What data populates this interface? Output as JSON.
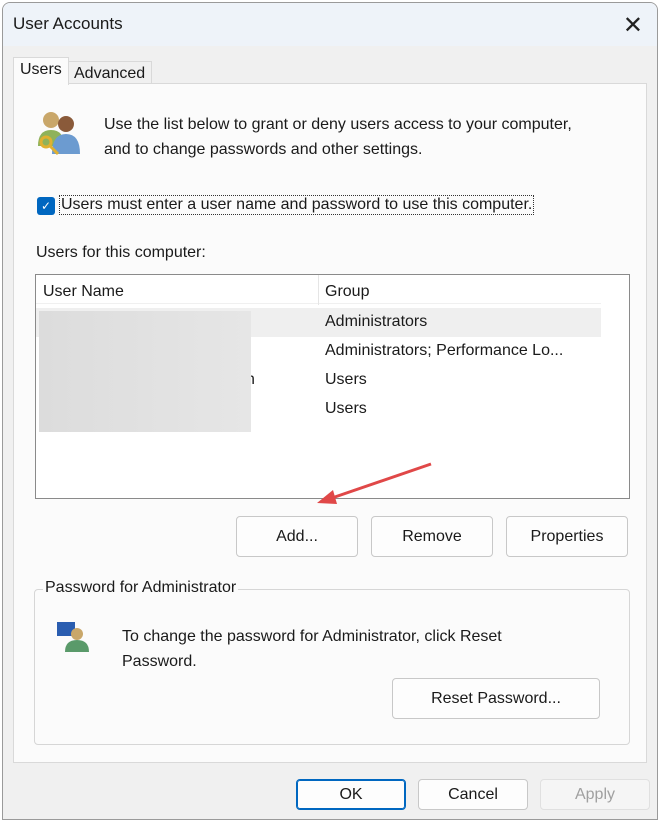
{
  "window": {
    "title": "User Accounts"
  },
  "tabs": [
    {
      "label": "Users",
      "active": true
    },
    {
      "label": "Advanced",
      "active": false
    }
  ],
  "intro": {
    "line1": "Use the list below to grant or deny users access to your computer,",
    "line2": "and to change passwords and other settings.",
    "icon": "users-key-icon"
  },
  "require_login": {
    "label": "Users must enter a user name and password to use this computer.",
    "checked": true
  },
  "users_label": "Users for this computer:",
  "table": {
    "columns": [
      "User Name",
      "Group"
    ],
    "rows": [
      {
        "name": "",
        "group": "Administrators",
        "selected": true
      },
      {
        "name": "",
        "group": "Administrators; Performance Lo..."
      },
      {
        "name": "n",
        "group": "Users"
      },
      {
        "name": "",
        "group": "Users"
      }
    ]
  },
  "buttons": {
    "add": "Add...",
    "remove": "Remove",
    "properties": "Properties",
    "reset": "Reset Password...",
    "ok": "OK",
    "cancel": "Cancel",
    "apply": "Apply"
  },
  "password_group": {
    "title": "Password for Administrator",
    "line1": "To change the password for Administrator, click Reset",
    "line2": "Password."
  },
  "colors": {
    "accent": "#0067c0",
    "arrow": "#e04848"
  }
}
